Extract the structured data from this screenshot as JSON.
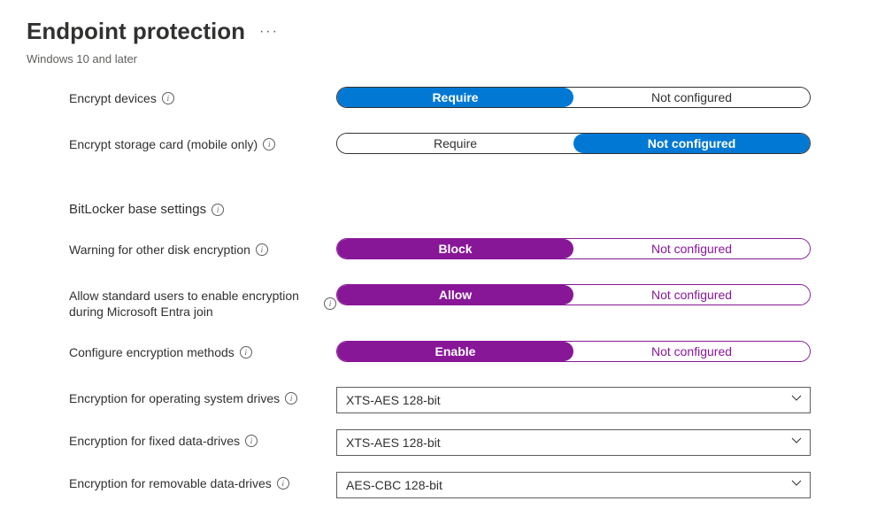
{
  "header": {
    "title": "Endpoint protection",
    "subtitle": "Windows 10 and later"
  },
  "toggles": {
    "encryptDevices": {
      "label": "Encrypt devices",
      "left": "Require",
      "right": "Not configured",
      "selected": "left",
      "theme": "blue"
    },
    "encryptStorageCard": {
      "label": "Encrypt storage card (mobile only)",
      "left": "Require",
      "right": "Not configured",
      "selected": "right",
      "theme": "blue"
    },
    "warningDiskEncryption": {
      "label": "Warning for other disk encryption",
      "left": "Block",
      "right": "Not configured",
      "selected": "left",
      "theme": "purple"
    },
    "allowStandardUsers": {
      "label": "Allow standard users to enable encryption during Microsoft Entra join",
      "left": "Allow",
      "right": "Not configured",
      "selected": "left",
      "theme": "purple"
    },
    "configureEncryption": {
      "label": "Configure encryption methods",
      "left": "Enable",
      "right": "Not configured",
      "selected": "left",
      "theme": "purple"
    }
  },
  "section": {
    "bitlocker": "BitLocker base settings"
  },
  "selects": {
    "osDrives": {
      "label": "Encryption for operating system drives",
      "value": "XTS-AES 128-bit"
    },
    "fixedDrives": {
      "label": "Encryption for fixed data-drives",
      "value": "XTS-AES 128-bit"
    },
    "removableDrives": {
      "label": "Encryption for removable data-drives",
      "value": "AES-CBC 128-bit"
    }
  }
}
